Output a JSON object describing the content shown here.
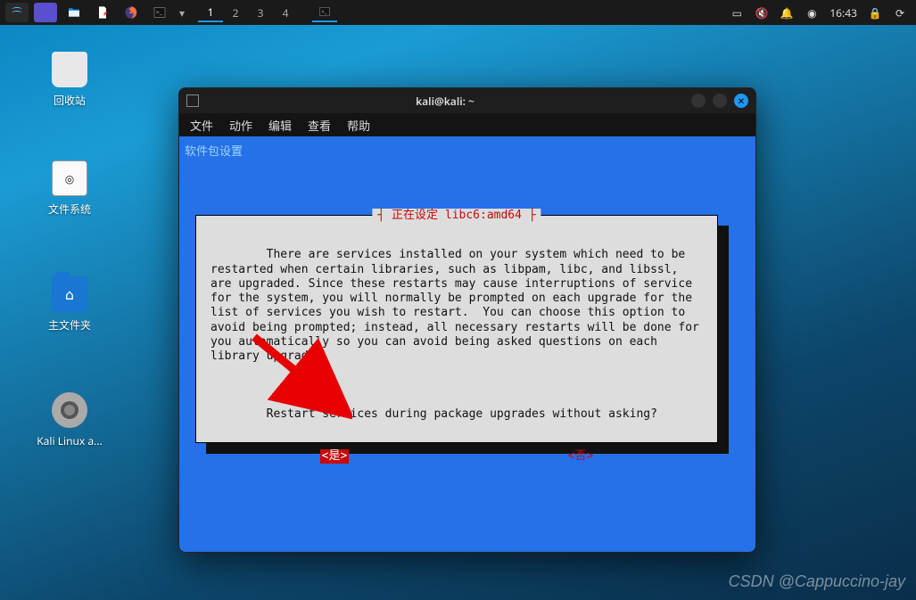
{
  "panel": {
    "workspaces": [
      "1",
      "2",
      "3",
      "4"
    ],
    "active_workspace": 0,
    "clock": "16:43"
  },
  "desktop": {
    "trash": "回收站",
    "filesystem": "文件系统",
    "home": "主文件夹",
    "kali_iso": "Kali Linux a..."
  },
  "window": {
    "title": "kali@kali: ~",
    "menu": {
      "file": "文件",
      "actions": "动作",
      "edit": "编辑",
      "view": "查看",
      "help": "帮助"
    }
  },
  "terminal": {
    "pkg_config": "软件包设置",
    "dialog_title": "正在设定 libc6:amd64",
    "body": "There are services installed on your system which need to be restarted when certain libraries, such as libpam, libc, and libssl, are upgraded. Since these restarts may cause interruptions of service for the system, you will normally be prompted on each upgrade for the list of services you wish to restart.  You can choose this option to avoid being prompted; instead, all necessary restarts will be done for you automatically so you can avoid being asked questions on each library upgrade.",
    "question": "Restart services during package upgrades without asking?",
    "yes": "<是>",
    "no": "<否>"
  },
  "watermark": "CSDN @Cappuccino-jay"
}
